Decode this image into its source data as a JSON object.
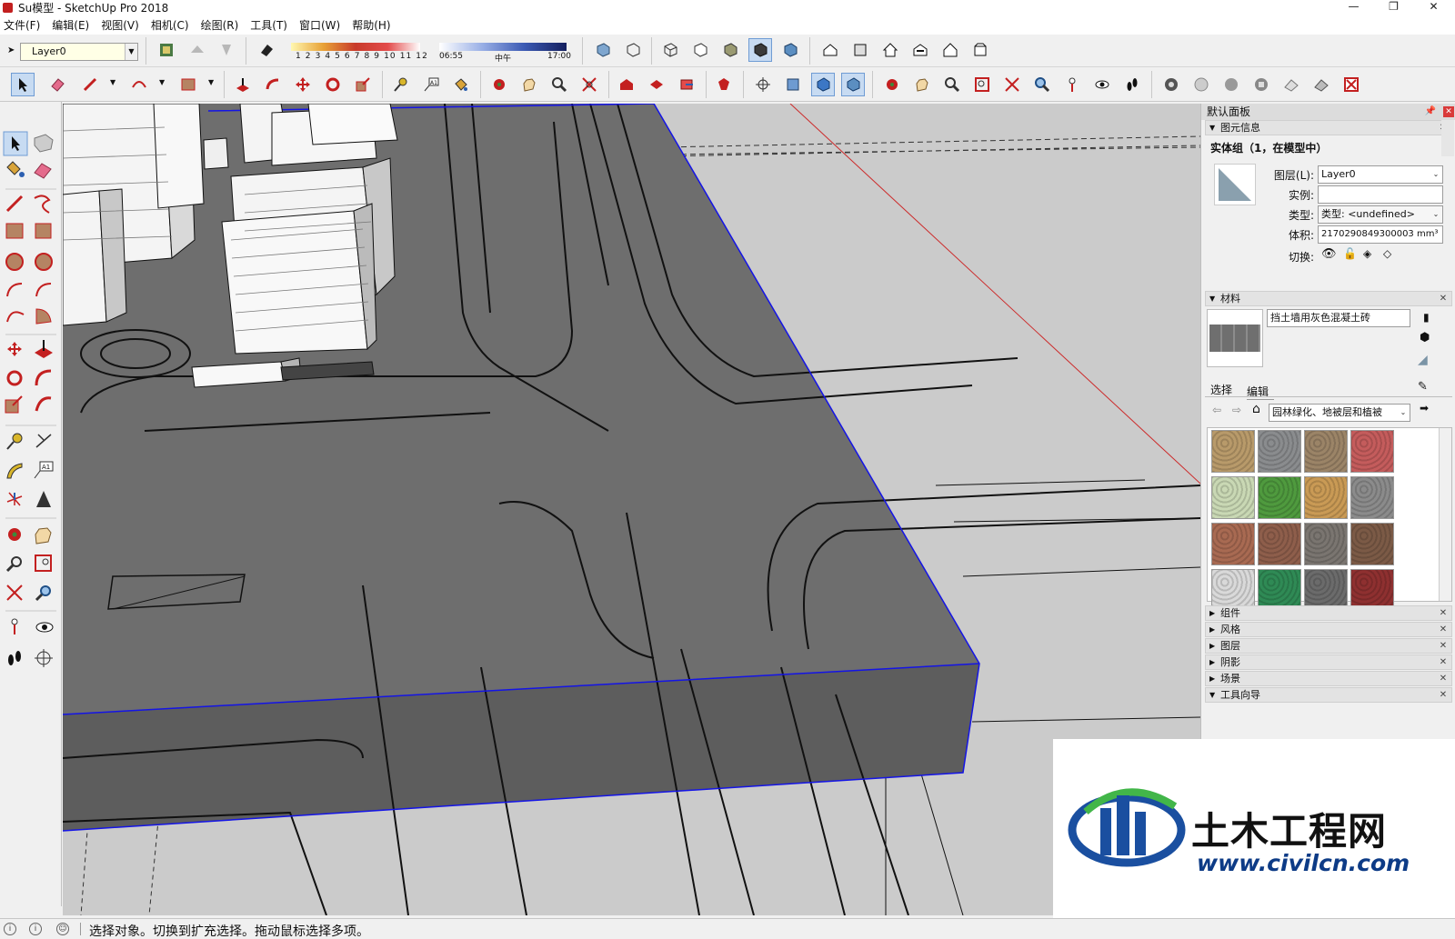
{
  "window": {
    "title": "Su模型 - SketchUp Pro 2018",
    "minimize": "—",
    "maximize": "❐",
    "close": "✕"
  },
  "menu": [
    "文件(F)",
    "编辑(E)",
    "视图(V)",
    "相机(C)",
    "绘图(R)",
    "工具(T)",
    "窗口(W)",
    "帮助(H)"
  ],
  "layer_toolbar": {
    "current_layer": "Layer0"
  },
  "shadow_toolbar": {
    "months": "1 2 3 4 5 6 7 8 9 10 11 12",
    "time_start": "06:55",
    "time_mid": "中午",
    "time_end": "17:00"
  },
  "default_panel": {
    "title": "默认面板",
    "entity_info": {
      "section": "图元信息",
      "heading": "实体组（1，在模型中）",
      "layer_label": "图层(L):",
      "layer_value": "Layer0",
      "instance_label": "实例:",
      "instance_value": "",
      "type_label": "类型:",
      "type_value": "类型: <undefined>",
      "volume_label": "体积:",
      "volume_value": "2170290849300003 mm³",
      "toggle_label": "切换:"
    },
    "materials": {
      "section": "材料",
      "current_name": "挡土墙用灰色混凝土砖",
      "tab_select": "选择",
      "tab_edit": "编辑",
      "library": "园林绿化、地被层和植被",
      "swatch_colors": [
        "#b89a6a",
        "#8a8c8e",
        "#9b8467",
        "#c45c5c",
        "#c9d8b4",
        "#4f9a3e",
        "#c99a55",
        "#8b8b8b",
        "#a86a52",
        "#8e5e4b",
        "#7a7570",
        "#7b5a46",
        "#d9d9d9",
        "#2f8a55",
        "#6b6b6b",
        "#8e3030"
      ]
    },
    "collapsed_sections": [
      "组件",
      "风格",
      "图层",
      "阴影",
      "场景"
    ],
    "last_section": "工具向导"
  },
  "status": {
    "message": "选择对象。切换到扩充选择。拖动鼠标选择多项。"
  },
  "watermark": {
    "brand": "土木工程网",
    "url": "www.civilcn.com"
  },
  "colors": {
    "selection_blue": "#1414e6",
    "ground": "#cbcbcb",
    "slab_top": "#6e6e6e",
    "slab_side": "#5d5d5d",
    "red_axis": "#cc2a2a"
  }
}
